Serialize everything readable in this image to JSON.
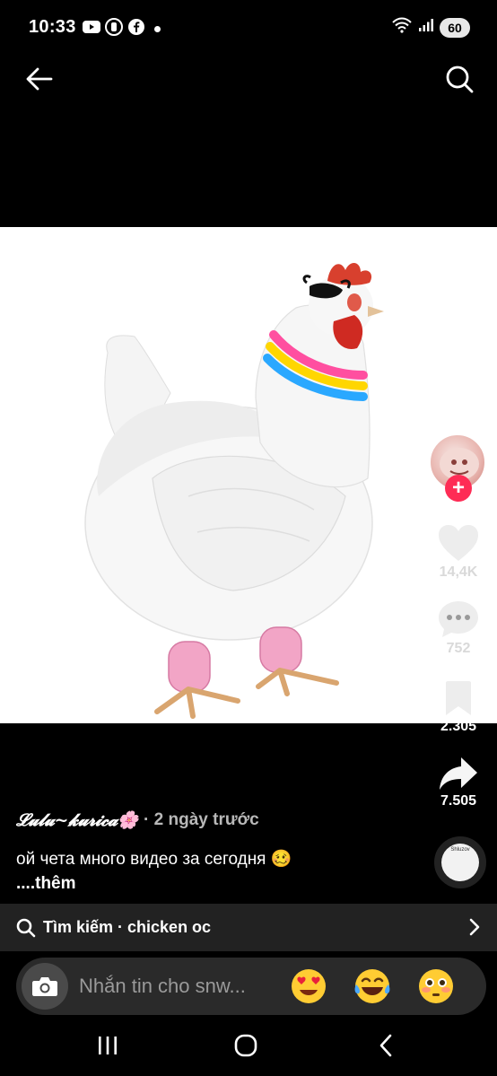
{
  "status_bar": {
    "time": "10:33",
    "battery": "60",
    "left_icons": [
      "youtube-icon",
      "recording-icon",
      "facebook-icon"
    ],
    "right_icons": [
      "wifi-icon",
      "signal-icon"
    ]
  },
  "top_nav": {
    "back_icon": "arrow-left-icon",
    "search_icon": "search-icon"
  },
  "video": {
    "subject": "chicken-sticker-image",
    "background": "#ffffff"
  },
  "actions": {
    "likes": "14,4K",
    "comments": "752",
    "saves": "2.305",
    "shares": "7.505"
  },
  "post": {
    "author": "𝓛𝓾𝓵𝓾~𝓴𝓾𝓻𝓲𝓬𝓪🌸",
    "time_ago": "· 2 ngày trước",
    "caption": "ой чета много видео за сегодня 🥴",
    "more": "....thêm"
  },
  "search_strip": {
    "label": "Tìm kiếm · chicken oc"
  },
  "comment_bar": {
    "placeholder": "Nhắn tin cho snw...",
    "emojis": [
      "😍",
      "😂",
      "😳"
    ]
  },
  "music_disc": {
    "label": "Shluzov"
  },
  "colors": {
    "accent": "#fe2c55",
    "background": "#000000",
    "search_strip_bg": "#222222",
    "comment_bar_bg": "#2a2a2a"
  }
}
